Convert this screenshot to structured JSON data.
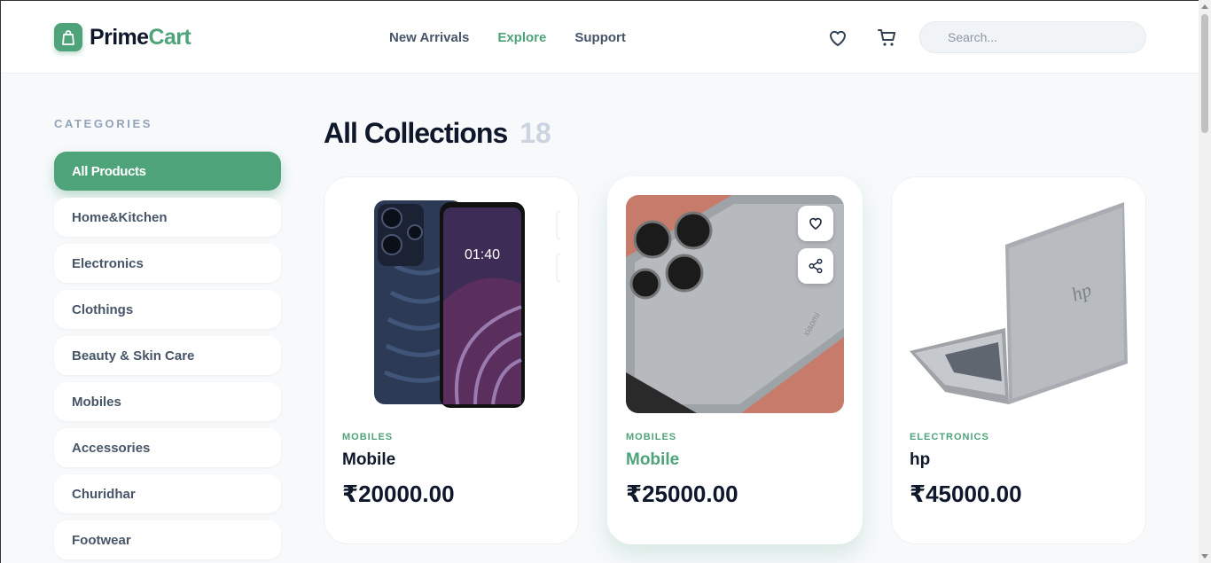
{
  "brand": {
    "name_part1": "Prime",
    "name_part2": "Cart",
    "accent_color": "#4fa37a"
  },
  "nav": [
    {
      "label": "New Arrivals",
      "active": false
    },
    {
      "label": "Explore",
      "active": true
    },
    {
      "label": "Support",
      "active": false
    }
  ],
  "header_icons": [
    "heart-icon",
    "cart-icon"
  ],
  "search": {
    "placeholder": "Search...",
    "value": ""
  },
  "sidebar": {
    "title": "CATEGORIES",
    "items": [
      {
        "label": "All Products",
        "active": true
      },
      {
        "label": "Home&Kitchen",
        "active": false
      },
      {
        "label": "Electronics",
        "active": false
      },
      {
        "label": "Clothings",
        "active": false
      },
      {
        "label": "Beauty & Skin Care",
        "active": false
      },
      {
        "label": "Mobiles",
        "active": false
      },
      {
        "label": "Accessories",
        "active": false
      },
      {
        "label": "Churidhar",
        "active": false
      },
      {
        "label": "Footwear",
        "active": false
      }
    ]
  },
  "main": {
    "title": "All Collections",
    "count": "18",
    "products": [
      {
        "category": "MOBILES",
        "name": "Mobile",
        "price": "₹20000.00",
        "image": "smartphone-front-back"
      },
      {
        "category": "MOBILES",
        "name": "Mobile",
        "price": "₹25000.00",
        "image": "xiaomi-phone-back",
        "hovered": true
      },
      {
        "category": "ELECTRONICS",
        "name": "hp",
        "price": "₹45000.00",
        "image": "hp-laptop"
      }
    ]
  },
  "card_actions": [
    "wishlist-button",
    "share-button"
  ]
}
